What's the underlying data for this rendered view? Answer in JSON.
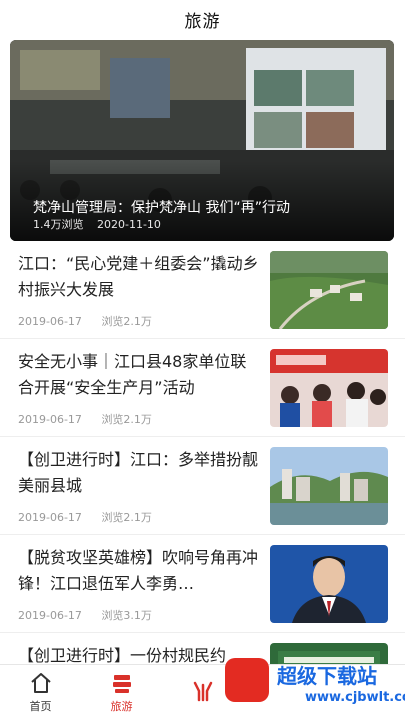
{
  "header": {
    "title": "旅游"
  },
  "hero": {
    "title": "梵净山管理局：保护梵净山 我们“再”行动",
    "views": "1.4万浏览",
    "date": "2020-11-10"
  },
  "news": [
    {
      "title": "江口：“民心党建＋组委会”撬动乡村振兴大发展",
      "date": "2019-06-17",
      "views": "浏览2.1万",
      "thumb": "village-aerial"
    },
    {
      "title": "安全无小事｜江口县48家单位联合开展“安全生产月”活动",
      "date": "2019-06-17",
      "views": "浏览2.1万",
      "thumb": "safety-event"
    },
    {
      "title": "【创卫进行时】江口：多举措扮靓美丽县城",
      "date": "2019-06-17",
      "views": "浏览2.1万",
      "thumb": "county-town"
    },
    {
      "title": "【脱贫攻坚英雄榜】吹响号角再冲锋！江口退伍军人李勇…",
      "date": "2019-06-17",
      "views": "浏览3.1万",
      "thumb": "portrait"
    },
    {
      "title": "【创卫进行时】一份村规民约",
      "date": "",
      "views": "",
      "thumb": "sign-board"
    }
  ],
  "tabbar": {
    "items": [
      {
        "label": "首页",
        "icon": "home-icon",
        "active": false
      },
      {
        "label": "旅游",
        "icon": "travel-icon",
        "active": true
      },
      {
        "label": "",
        "icon": "center-icon",
        "active": false
      },
      {
        "label": "",
        "icon": "",
        "active": false
      },
      {
        "label": "",
        "icon": "",
        "active": false
      }
    ]
  },
  "watermark": {
    "text": "超级下载站",
    "url": "www.cjbwlt.com"
  },
  "colors": {
    "accent": "#d9312a",
    "watermark_blue": "#1a68e0"
  }
}
